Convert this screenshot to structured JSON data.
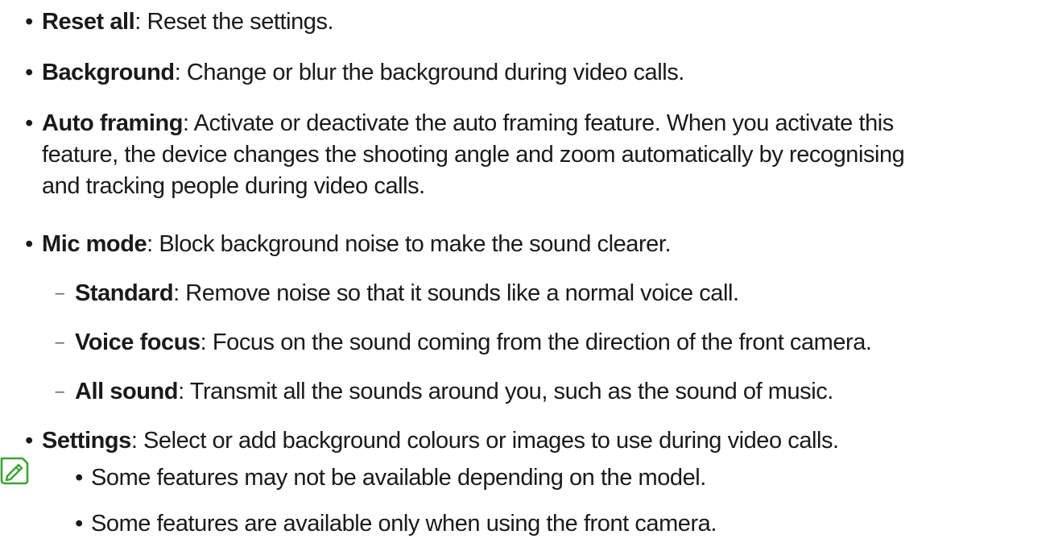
{
  "items": [
    {
      "term": "Reset all",
      "desc": ": Reset the settings."
    },
    {
      "term": "Background",
      "desc": ": Change or blur the background during video calls."
    },
    {
      "term": "Auto framing",
      "desc": ": Activate or deactivate the auto framing feature. When you activate this",
      "cont1": "feature, the device changes the shooting angle and zoom automatically by recognising",
      "cont2": "and tracking people during video calls."
    },
    {
      "term": "Mic mode",
      "desc": ": Block background noise to make the sound clearer."
    },
    {
      "term": "Settings",
      "desc": ": Select or add background colours or images to use during video calls."
    }
  ],
  "sub_items": [
    {
      "term": "Standard",
      "desc": ": Remove noise so that it sounds like a normal voice call."
    },
    {
      "term": "Voice focus",
      "desc": ": Focus on the sound coming from the direction of the front camera."
    },
    {
      "term": "All sound",
      "desc": ": Transmit all the sounds around you, such as the sound of music."
    }
  ],
  "notes": [
    "Some features may not be available depending on the model.",
    "Some features are available only when using the front camera."
  ],
  "markers": {
    "bullet": "•",
    "dash": "–"
  },
  "icons": {
    "note": "note-pencil-icon"
  },
  "colors": {
    "text": "#1a1a1a",
    "note_icon": "#3aa335"
  }
}
